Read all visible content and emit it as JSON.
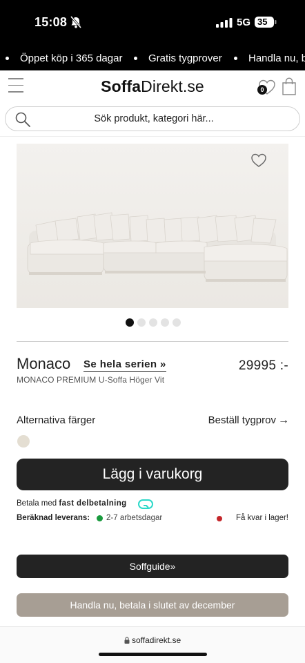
{
  "status_bar": {
    "time": "15:08",
    "network": "5G",
    "battery": "35"
  },
  "ticker": {
    "items": [
      "Öppet köp i 365 dagar",
      "Gratis tygprover",
      "Handla nu, b"
    ]
  },
  "header": {
    "logo_bold": "Soffa",
    "logo_light": "Direkt.se",
    "wishlist_count": "0"
  },
  "search": {
    "placeholder": "Sök produkt, kategori här..."
  },
  "carousel": {
    "slide_count": 5,
    "active_index": 0
  },
  "product": {
    "name": "Monaco",
    "series_link": "Se hela serien »",
    "price": "29995 :-",
    "subtitle": "MONACO PREMIUM U-Soffa Höger Vit",
    "alt_colors_label": "Alternativa färger",
    "fabric_sample_link": "Beställ tygprov",
    "fabric_sample_arrow": "→",
    "swatch_color": "#e4ded2"
  },
  "actions": {
    "add_to_cart": "Lägg i varukorg",
    "soffguide": "Soffguide»",
    "klarna_offer": "Handla nu, betala i slutet av december"
  },
  "payment": {
    "prefix": "Betala med",
    "method": "fast delbetalning"
  },
  "delivery": {
    "label": "Beräknad leverans:",
    "days": "2-7 arbetsdagar",
    "stock": "Få kvar i lager!"
  },
  "browser": {
    "url": "soffadirekt.se"
  },
  "colors": {
    "dark_button": "#232323",
    "klarna_button": "#a79e94",
    "in_stock_green": "#1a9a3e",
    "low_stock_red": "#c4262a",
    "klarna_accent": "#2ad8c8"
  }
}
